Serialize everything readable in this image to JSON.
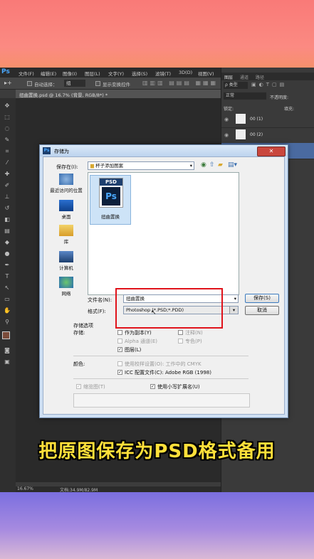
{
  "app": {
    "logo": "Ps",
    "menu": [
      "文件(F)",
      "编辑(E)",
      "图像(I)",
      "图层(L)",
      "文字(Y)",
      "选择(S)",
      "滤镜(T)",
      "3D(D)",
      "视图(V)"
    ],
    "options_bar": {
      "auto_select": "自动选择：",
      "auto_select_value": "组",
      "show_transform": "显示变换控件"
    },
    "document_tab": "扭曲置换.psd @ 16.7% (背景, RGB/8*) *",
    "status_zoom": "16.67%",
    "status_doc": "文档:34.9M/82.9M"
  },
  "panels": {
    "tabs": [
      "图层",
      "通道",
      "路径"
    ],
    "kind_filter": "ρ 类型",
    "blend_mode": "正常",
    "opacity_label": "不透明度:",
    "lock_label": "锁定:",
    "fill_label": "填充:",
    "layers": [
      "00 (1)",
      "00 (2)"
    ]
  },
  "dialog": {
    "title": "存储为",
    "save_in_label": "保存在(I):",
    "save_in_value": "杯子添加图案",
    "places": [
      {
        "label": "最近访问的位置",
        "icon": "recent-places-icon"
      },
      {
        "label": "桌面",
        "icon": "desktop-icon"
      },
      {
        "label": "库",
        "icon": "libraries-icon"
      },
      {
        "label": "计算机",
        "icon": "computer-icon"
      },
      {
        "label": "网络",
        "icon": "network-icon"
      }
    ],
    "file": {
      "badge": "PSD",
      "icon_text": "Ps",
      "name": "扭曲置换"
    },
    "filename_label": "文件名(N):",
    "filename_value": "扭曲置换",
    "format_label": "格式(F):",
    "format_value": "Photoshop (*.PSD;*.PDD)",
    "save_button": "保存(S)",
    "cancel_button": "取消",
    "save_options_title": "存储选项",
    "save_label": "存储:",
    "options": {
      "as_copy": "作为副本(Y)",
      "notes": "注释(N)",
      "alpha": "Alpha 通道(E)",
      "spot": "专色(P)",
      "layers": "图层(L)"
    },
    "color_label": "颜色:",
    "use_proof": "使用校样设置(O): 工作中的 CMYK",
    "icc_profile": "ICC 配置文件(C): Adobe RGB (1998)",
    "thumbnail": "缩览图(T)",
    "lowercase_ext": "使用小写扩展名(U)"
  },
  "caption": "把原图保存为PSD格式备用"
}
